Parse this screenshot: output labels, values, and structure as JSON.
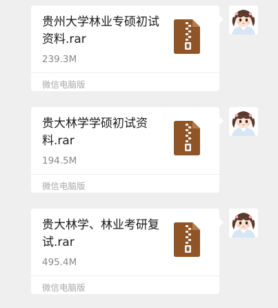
{
  "messages": [
    {
      "file_name": "贵州大学林业专硕初试资料.rar",
      "file_size": "239.3M",
      "source": "微信电脑版",
      "icon": "zip-file-icon"
    },
    {
      "file_name": "贵大林学学硕初试资料.rar",
      "file_size": "194.5M",
      "source": "微信电脑版",
      "icon": "zip-file-icon"
    },
    {
      "file_name": "贵大林学、林业考研复试.rar",
      "file_size": "495.4M",
      "source": "微信电脑版",
      "icon": "zip-file-icon"
    }
  ],
  "colors": {
    "background": "#efefef",
    "bubble": "#ffffff",
    "file_icon": "#8f5526",
    "zipper": "#f3f3f3"
  }
}
